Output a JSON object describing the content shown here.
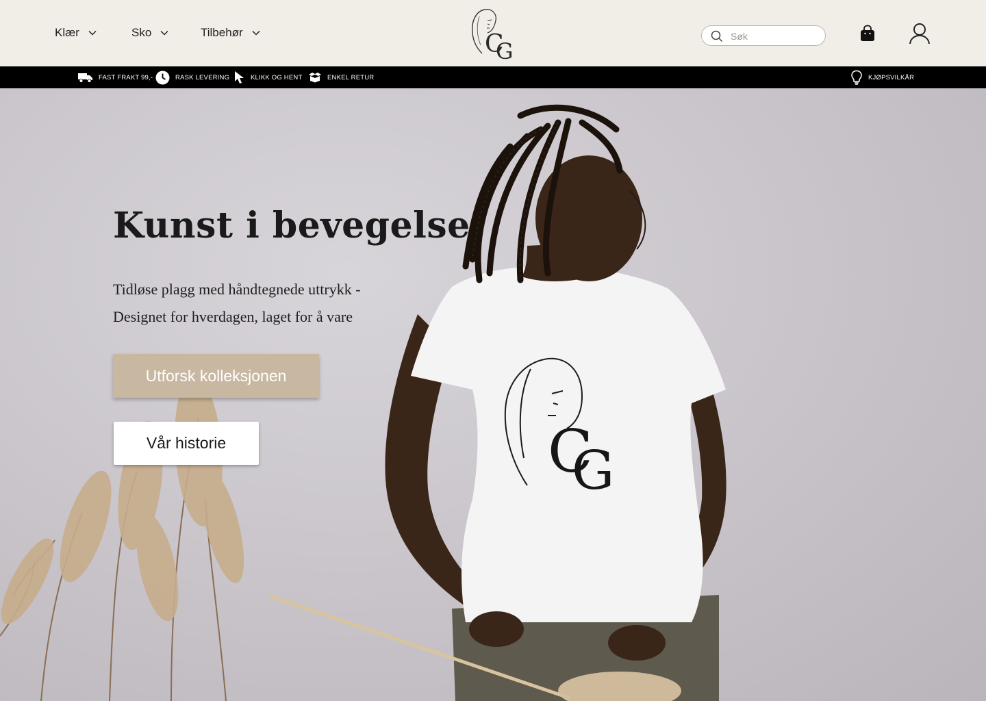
{
  "nav": {
    "items": [
      {
        "label": "Klær"
      },
      {
        "label": "Sko"
      },
      {
        "label": "Tilbehør"
      }
    ]
  },
  "logo": {
    "text": "CG"
  },
  "search": {
    "placeholder": "Søk"
  },
  "usp": {
    "items": [
      {
        "label": "FAST FRAKT 99,-",
        "icon": "truck-icon"
      },
      {
        "label": "RASK LEVERING",
        "icon": "clock-icon"
      },
      {
        "label": "KLIKK OG HENT",
        "icon": "cursor-icon"
      },
      {
        "label": "ENKEL RETUR",
        "icon": "box-icon"
      }
    ],
    "terms": {
      "label": "KJØPSVILKÅR",
      "icon": "lightbulb-icon"
    }
  },
  "hero": {
    "title": "Kunst i bevegelse",
    "subtitle_line1": "Tidløse plagg med håndtegnede uttrykk -",
    "subtitle_line2": "Designet for hverdagen, laget for å vare",
    "primary_button": "Utforsk kolleksjonen",
    "secondary_button": "Vår historie"
  },
  "colors": {
    "header_bg": "#f1ede7",
    "usp_bg": "#000000",
    "accent": "#c8b8a2"
  }
}
